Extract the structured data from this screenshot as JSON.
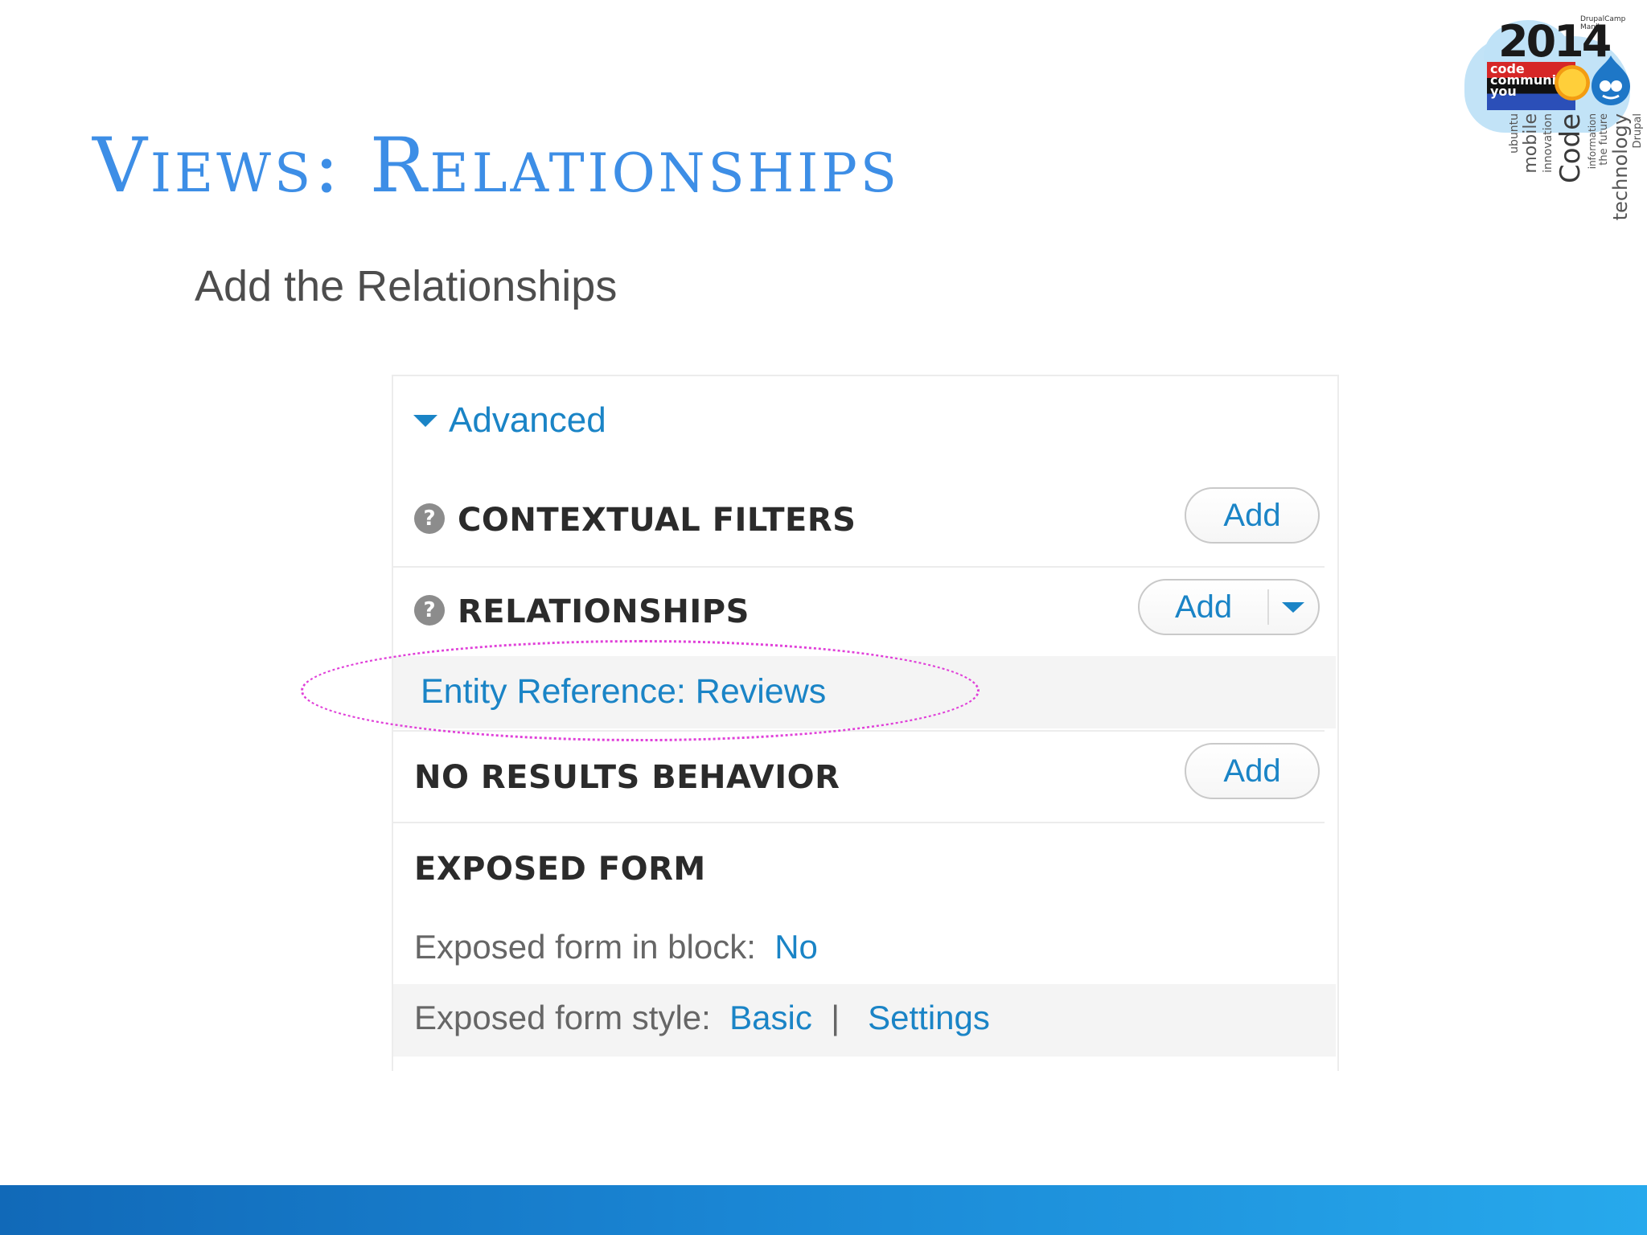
{
  "slide": {
    "title": "Views: Relationships",
    "subtitle": "Add the Relationships"
  },
  "logo": {
    "year": "2014",
    "small_caption": "DrupalCamp Manila",
    "tags": [
      "code",
      "community",
      "you"
    ],
    "words": [
      "Code",
      "technology",
      "mobile",
      "innovation",
      "Drupal",
      "information",
      "the future",
      "ubuntu"
    ]
  },
  "panel": {
    "advanced_label": "Advanced",
    "sections": {
      "contextual_filters": {
        "heading": "CONTEXTUAL FILTERS",
        "add_label": "Add"
      },
      "relationships": {
        "heading": "RELATIONSHIPS",
        "add_label": "Add",
        "item": "Entity Reference: Reviews"
      },
      "no_results": {
        "heading": "NO RESULTS BEHAVIOR",
        "add_label": "Add"
      },
      "exposed_form": {
        "heading": "EXPOSED FORM",
        "in_block_label": "Exposed form in block:",
        "in_block_value": "No",
        "style_label": "Exposed form style:",
        "style_value": "Basic",
        "separator": "|",
        "settings_label": "Settings"
      }
    }
  },
  "colors": {
    "title": "#3d8ee6",
    "link": "#1a84c6",
    "highlight_ellipse": "#e040d9",
    "footer_bar": "#1a86d4"
  },
  "icons": [
    "help-icon",
    "chevron-down-icon",
    "drupal-drop-icon"
  ]
}
